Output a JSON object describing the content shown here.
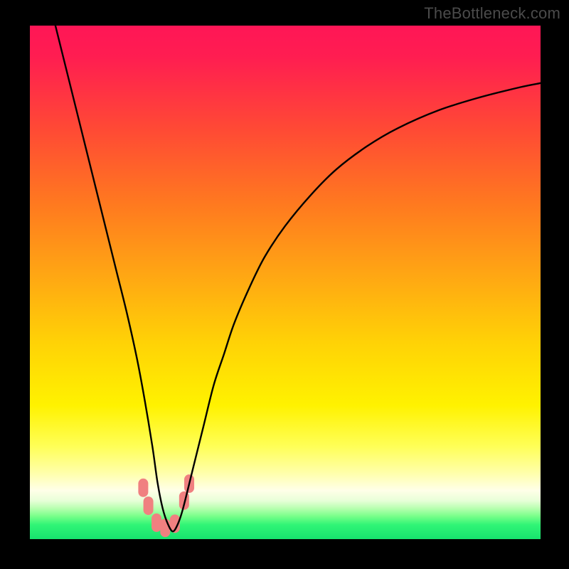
{
  "watermark": "TheBottleneck.com",
  "chart_data": {
    "type": "line",
    "title": "",
    "xlabel": "",
    "ylabel": "",
    "xlim": [
      0,
      100
    ],
    "ylim": [
      0,
      100
    ],
    "grid": false,
    "legend": false,
    "gradient_stops": [
      {
        "offset": 0.0,
        "color": "#ff1656"
      },
      {
        "offset": 0.06,
        "color": "#ff1d51"
      },
      {
        "offset": 0.2,
        "color": "#ff4935"
      },
      {
        "offset": 0.35,
        "color": "#ff7a1f"
      },
      {
        "offset": 0.5,
        "color": "#ffab12"
      },
      {
        "offset": 0.62,
        "color": "#ffd306"
      },
      {
        "offset": 0.74,
        "color": "#fff200"
      },
      {
        "offset": 0.82,
        "color": "#ffff58"
      },
      {
        "offset": 0.87,
        "color": "#ffffa8"
      },
      {
        "offset": 0.905,
        "color": "#ffffe8"
      },
      {
        "offset": 0.925,
        "color": "#e8ffd8"
      },
      {
        "offset": 0.94,
        "color": "#b8ffb0"
      },
      {
        "offset": 0.955,
        "color": "#7Aff8a"
      },
      {
        "offset": 0.972,
        "color": "#30f576"
      },
      {
        "offset": 1.0,
        "color": "#17e36e"
      }
    ],
    "series": [
      {
        "name": "bottleneck-curve",
        "color": "#000000",
        "x": [
          5,
          7,
          9,
          11,
          13,
          15,
          17,
          19,
          21,
          22.5,
          24,
          25,
          26,
          27,
          28,
          29,
          30,
          32,
          34,
          36,
          38,
          40,
          43,
          46,
          50,
          55,
          60,
          66,
          72,
          80,
          88,
          96,
          100
        ],
        "y": [
          100,
          92,
          84,
          76,
          68,
          60,
          52,
          44,
          35,
          27,
          18,
          11,
          6,
          3,
          1.5,
          3,
          6,
          14,
          22,
          30,
          36,
          42,
          49,
          55,
          61,
          67,
          72,
          76.5,
          80,
          83.5,
          86,
          88,
          88.8
        ]
      }
    ],
    "markers": {
      "name": "highlight-dots",
      "color": "#f08080",
      "points": [
        {
          "x": 22.2,
          "y": 10.0
        },
        {
          "x": 23.2,
          "y": 6.5
        },
        {
          "x": 24.8,
          "y": 3.2
        },
        {
          "x": 26.5,
          "y": 2.2
        },
        {
          "x": 28.4,
          "y": 3.0
        },
        {
          "x": 30.2,
          "y": 7.5
        },
        {
          "x": 31.2,
          "y": 10.8
        }
      ]
    }
  }
}
